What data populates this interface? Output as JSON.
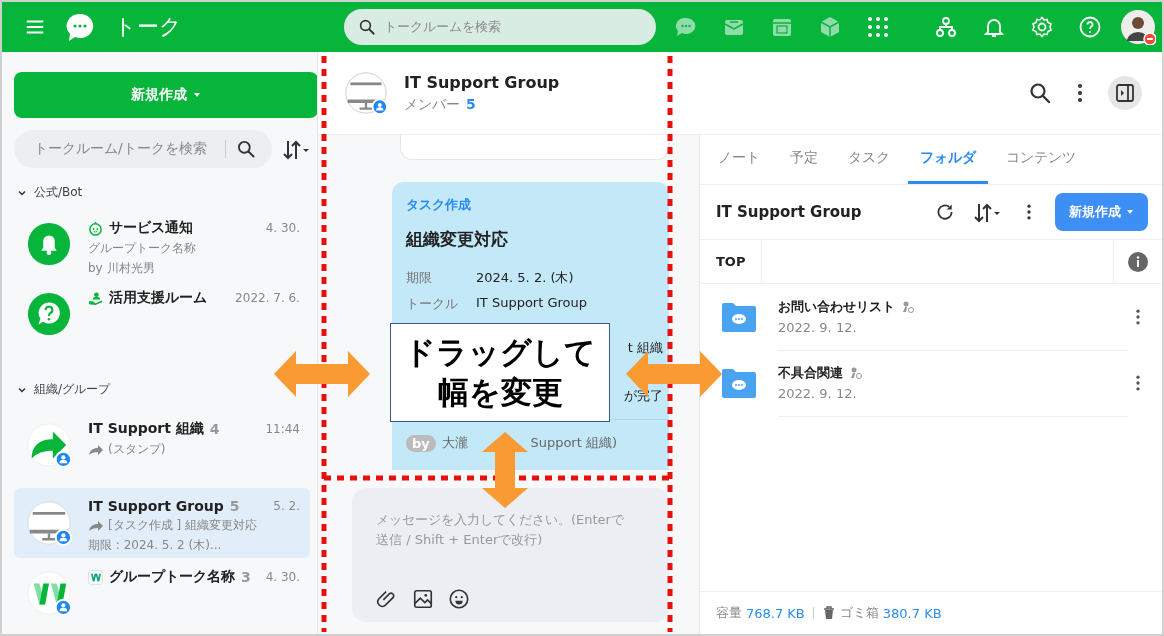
{
  "topbar": {
    "title": "トーク",
    "search": {
      "placeholder": "トークルームを検索"
    }
  },
  "sidebar": {
    "new_button": "新規作成",
    "search": {
      "placeholder": "トークルーム/トークを検索"
    },
    "sections": [
      {
        "title": "公式/Bot",
        "expanded": true,
        "items": [
          {
            "kind": "notice",
            "name": "サービス通知",
            "time": "4. 30.",
            "forwarded": false,
            "selected": false,
            "lines": [
              "グループトーク名称",
              "by 川村光男"
            ]
          },
          {
            "kind": "help",
            "name": "活用支援ルーム",
            "time": "2022. 7. 6.",
            "selected": false
          }
        ]
      },
      {
        "title": "組織/グループ",
        "expanded": true,
        "items": [
          {
            "kind": "org",
            "name": "IT Support 組織",
            "count": "4",
            "time": "11:44",
            "forwarded": true,
            "selected": false,
            "lines": [
              "(スタンプ)"
            ]
          },
          {
            "kind": "group",
            "name": "IT Support Group",
            "count": "5",
            "time": "5. 2.",
            "forwarded": true,
            "selected": true,
            "lines": [
              "[タスク作成 ] 組織変更対応",
              "期限 : 2024. 5. 2 (木)..."
            ]
          },
          {
            "kind": "app",
            "name": "グループトーク名称",
            "count": "3",
            "time": "4. 30.",
            "selected": false
          }
        ]
      }
    ]
  },
  "chat": {
    "title": "IT Support Group",
    "members_label": "メンバー",
    "members_count": "5",
    "task_card": {
      "label": "タスク作成",
      "title": "組織変更対応",
      "rows": [
        {
          "label": "期限",
          "value": "2024. 5. 2. (木)"
        },
        {
          "label": "トークル",
          "value": "IT Support Group"
        }
      ],
      "partial_rows": [
        "t 組織",
        "が完了"
      ],
      "by": "by",
      "author": "大瀧",
      "author_rest": "Support 組織)"
    },
    "composer": {
      "placeholder": "メッセージを入力してください。(Enterで送信 / Shift + Enterで改行)"
    }
  },
  "panel": {
    "tabs": [
      {
        "label": "ノート",
        "selected": false
      },
      {
        "label": "予定",
        "selected": false
      },
      {
        "label": "タスク",
        "selected": false
      },
      {
        "label": "フォルダ",
        "selected": true
      },
      {
        "label": "コンテンツ",
        "selected": false
      }
    ],
    "title": "IT Support Group",
    "new_button": "新規作成",
    "breadcrumb": "TOP",
    "folders": [
      {
        "name": "お問い合わせリスト",
        "date": "2022. 9. 12."
      },
      {
        "name": "不具合関連",
        "date": "2022. 9. 12."
      }
    ],
    "footer": {
      "capacity_label": "容量",
      "capacity": "768.7 KB",
      "trash_label": "ゴミ箱",
      "trash": "380.7 KB"
    }
  },
  "annotation": {
    "callout": "ドラッグして幅を変更"
  }
}
